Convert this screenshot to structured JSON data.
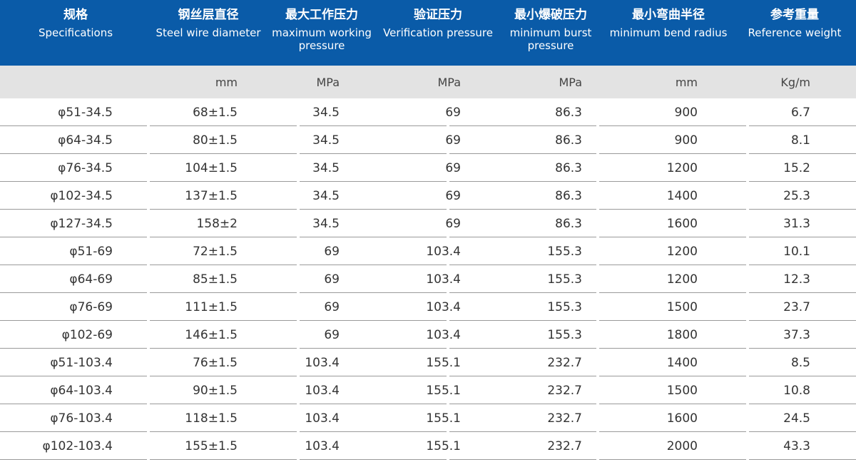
{
  "headers": [
    {
      "zh": "规格",
      "en": "Specifications",
      "en2": ""
    },
    {
      "zh": "钢丝层直径",
      "en": "Steel wire diameter",
      "en2": ""
    },
    {
      "zh": "最大工作压力",
      "en": "maximum working",
      "en2": "pressure"
    },
    {
      "zh": "验证压力",
      "en": "Verification pressure",
      "en2": ""
    },
    {
      "zh": "最小爆破压力",
      "en": "minimum burst",
      "en2": "pressure"
    },
    {
      "zh": "最小弯曲半径",
      "en": "minimum bend radius",
      "en2": ""
    },
    {
      "zh": "参考重量",
      "en": "Reference weight",
      "en2": ""
    }
  ],
  "units": [
    "",
    "mm",
    "MPa",
    "MPa",
    "MPa",
    "mm",
    "Kg/m"
  ],
  "rows": [
    [
      "φ51-34.5",
      "68±1.5",
      "34.5",
      "69",
      "86.3",
      "900",
      "6.7"
    ],
    [
      "φ64-34.5",
      "80±1.5",
      "34.5",
      "69",
      "86.3",
      "900",
      "8.1"
    ],
    [
      "φ76-34.5",
      "104±1.5",
      "34.5",
      "69",
      "86.3",
      "1200",
      "15.2"
    ],
    [
      "φ102-34.5",
      "137±1.5",
      "34.5",
      "69",
      "86.3",
      "1400",
      "25.3"
    ],
    [
      "φ127-34.5",
      "158±2",
      "34.5",
      "69",
      "86.3",
      "1600",
      "31.3"
    ],
    [
      "φ51-69",
      "72±1.5",
      "69",
      "103.4",
      "155.3",
      "1200",
      "10.1"
    ],
    [
      "φ64-69",
      "85±1.5",
      "69",
      "103.4",
      "155.3",
      "1200",
      "12.3"
    ],
    [
      "φ76-69",
      "111±1.5",
      "69",
      "103.4",
      "155.3",
      "1500",
      "23.7"
    ],
    [
      "φ102-69",
      "146±1.5",
      "69",
      "103.4",
      "155.3",
      "1800",
      "37.3"
    ],
    [
      "φ51-103.4",
      "76±1.5",
      "103.4",
      "155.1",
      "232.7",
      "1400",
      "8.5"
    ],
    [
      "φ64-103.4",
      "90±1.5",
      "103.4",
      "155.1",
      "232.7",
      "1500",
      "10.8"
    ],
    [
      "φ76-103.4",
      "118±1.5",
      "103.4",
      "155.1",
      "232.7",
      "1600",
      "24.5"
    ],
    [
      "φ102-103.4",
      "155±1.5",
      "103.4",
      "155.1",
      "232.7",
      "2000",
      "43.3"
    ]
  ],
  "colors": {
    "header_bg": "#0a5ba8",
    "units_bg": "#e3e3e3"
  }
}
